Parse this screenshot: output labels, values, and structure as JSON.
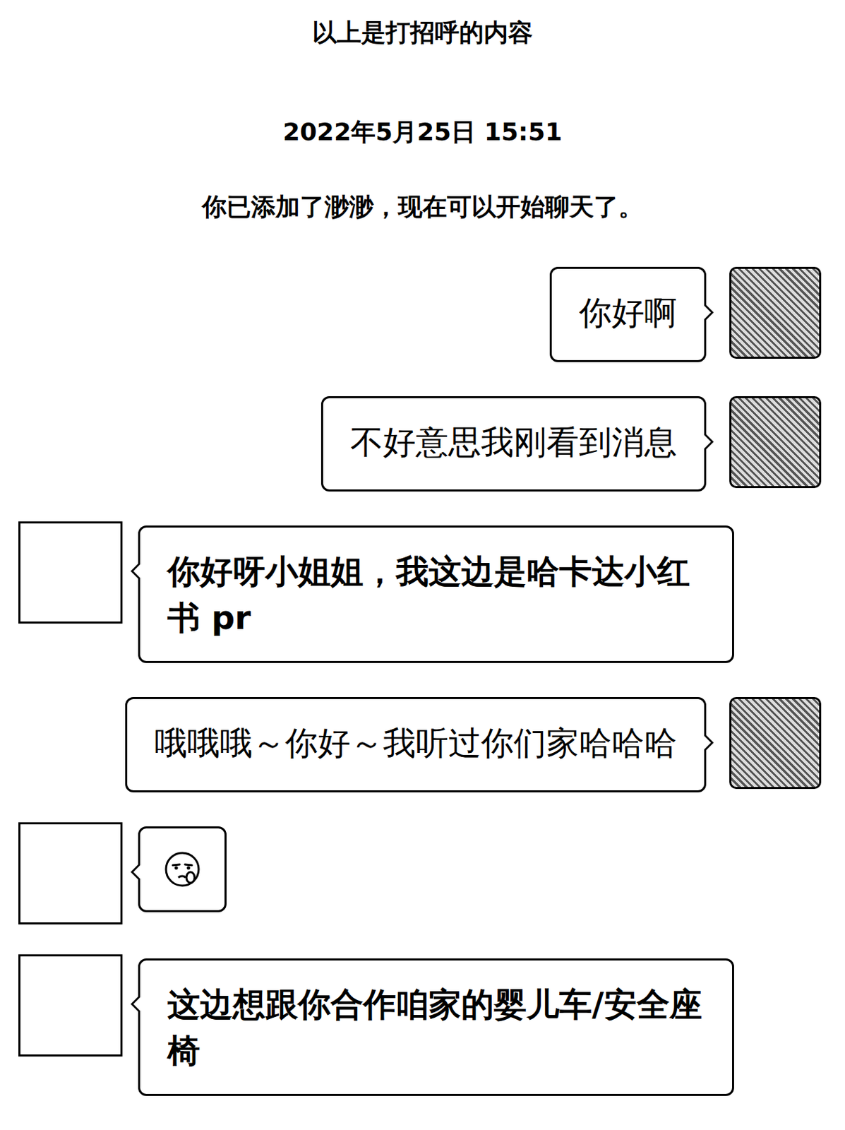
{
  "notices": [
    {
      "text": "以上是打招呼的内容",
      "kind": "hint"
    },
    {
      "text": "2022年5月25日 15:51",
      "kind": "time"
    },
    {
      "text": "你已添加了渺渺，现在可以开始聊天了。",
      "kind": "system"
    }
  ],
  "messages": [
    {
      "side": "right",
      "kind": "text",
      "text": "你好啊"
    },
    {
      "side": "right",
      "kind": "text",
      "text": "不好意思我刚看到消息"
    },
    {
      "side": "left",
      "kind": "text",
      "text": "你好呀小姐姐，我这边是哈卡达小红书 pr"
    },
    {
      "side": "right",
      "kind": "text",
      "text": "哦哦哦～你好～我听过你们家哈哈哈"
    },
    {
      "side": "left",
      "kind": "emoji",
      "text": ""
    },
    {
      "side": "left",
      "kind": "text",
      "text": "这边想跟你合作咱家的婴儿车/安全座椅"
    }
  ]
}
